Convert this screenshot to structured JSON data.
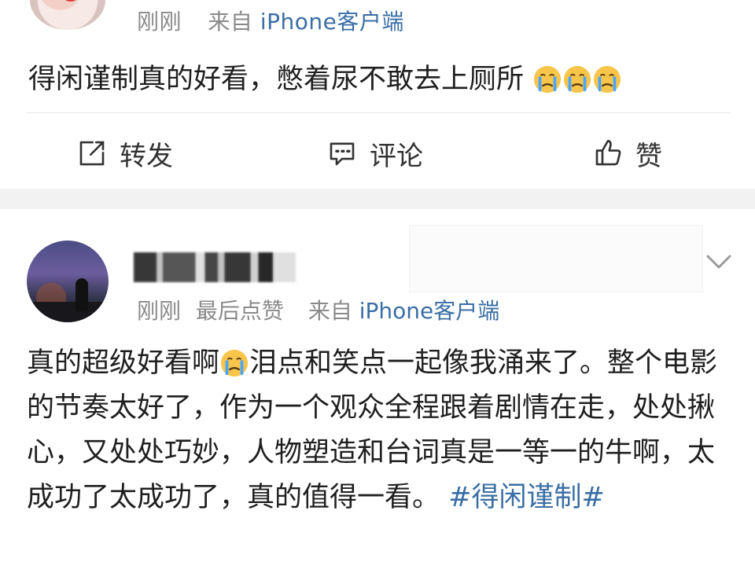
{
  "post1": {
    "meta": {
      "time": "刚刚",
      "source_prefix": "来自",
      "source": "iPhone客户端"
    },
    "text": "得闲谨制真的好看，憋着尿不敢去上厕所",
    "emojis": [
      "crying-face-emoji",
      "crying-face-emoji",
      "crying-face-emoji"
    ],
    "actions": {
      "repost": "转发",
      "comment": "评论",
      "like": "赞"
    }
  },
  "post2": {
    "meta": {
      "time": "刚刚",
      "like_note": "最后点赞",
      "source_prefix": "来自",
      "source": "iPhone客户端"
    },
    "text_part1": "真的超级好看啊",
    "text_part2": "泪点和笑点一起像我涌来了。整个电影的节奏太好了，作为一个观众全程跟着剧情在走，处处揪心，又处处巧妙，人物塑造和台词真是一等一的牛啊，太成功了太成功了，真的值得一看。",
    "hashtag": "#得闲谨制#"
  },
  "colors": {
    "accent": "#3a6ea5",
    "muted": "#8a8a8a",
    "separator": "#f2f2f2"
  }
}
